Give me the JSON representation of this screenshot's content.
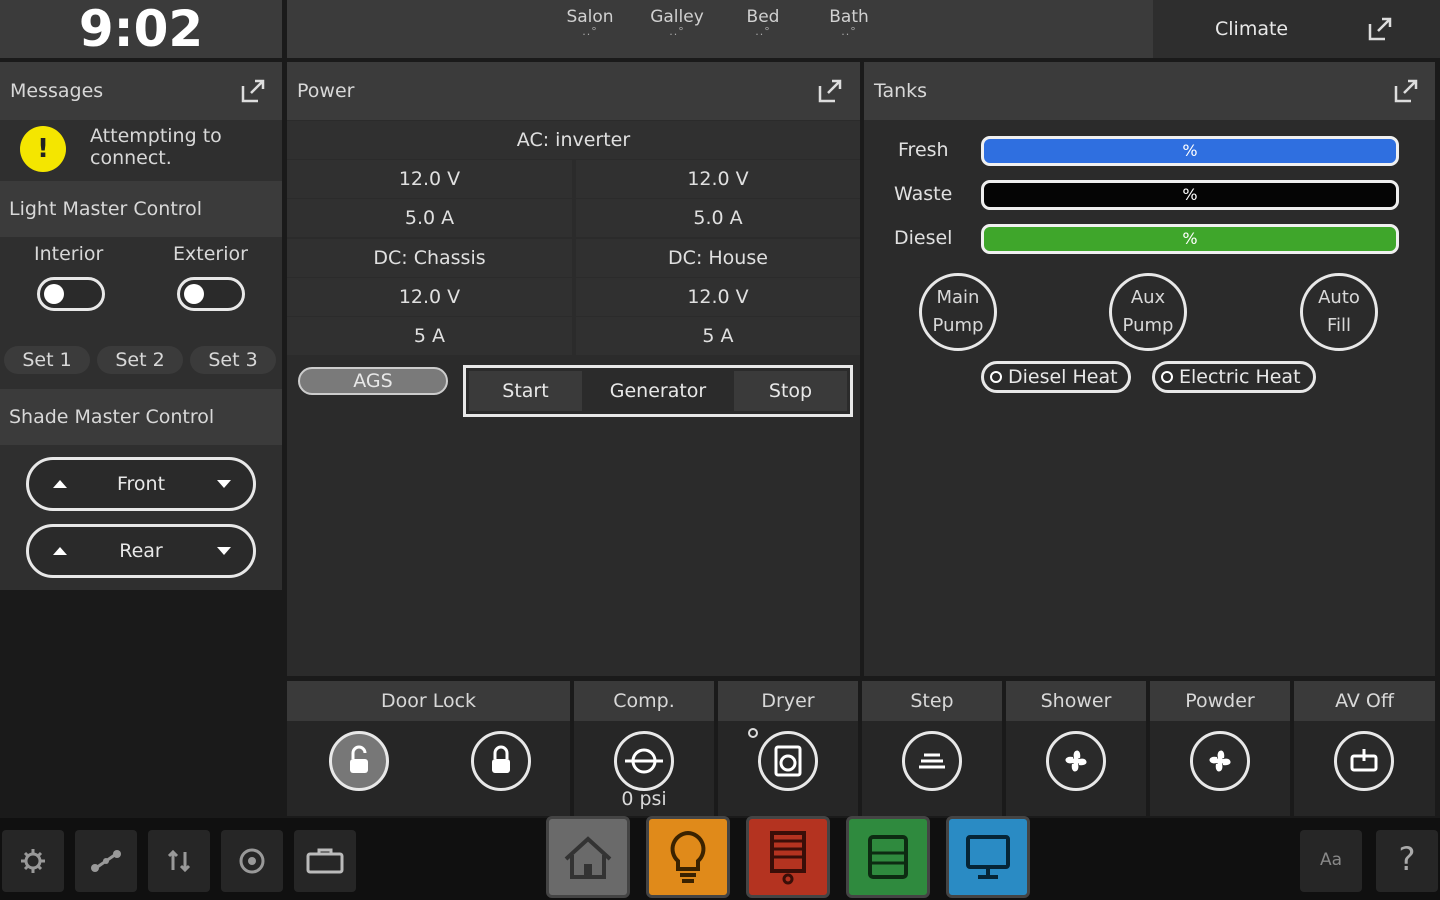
{
  "header": {
    "time": "9:02",
    "rooms": [
      "Salon",
      "Galley",
      "Bed",
      "Bath"
    ],
    "room_indicator": "..°",
    "climate_label": "Climate"
  },
  "messages": {
    "title": "Messages",
    "warning_text": "Attempting to connect.",
    "warning_glyph": "!"
  },
  "light_master": {
    "title": "Light Master Control",
    "interior_label": "Interior",
    "exterior_label": "Exterior",
    "sets": [
      "Set 1",
      "Set 2",
      "Set 3"
    ]
  },
  "shade_master": {
    "title": "Shade Master Control",
    "front_label": "Front",
    "rear_label": "Rear"
  },
  "power": {
    "title": "Power",
    "ac_label": "AC: inverter",
    "ac_v_left": "12.0 V",
    "ac_v_right": "12.0 V",
    "ac_a_left": "5.0 A",
    "ac_a_right": "5.0 A",
    "dc_chassis_label": "DC: Chassis",
    "dc_house_label": "DC: House",
    "dc_chassis_v": "12.0 V",
    "dc_house_v": "12.0 V",
    "dc_chassis_a": "5 A",
    "dc_house_a": "5 A",
    "ags_label": "AGS",
    "gen_start": "Start",
    "gen_label": "Generator",
    "gen_stop": "Stop"
  },
  "tanks": {
    "title": "Tanks",
    "fresh_label": "Fresh",
    "waste_label": "Waste",
    "diesel_label": "Diesel",
    "fresh_value": "%",
    "waste_value": "%",
    "diesel_value": "%",
    "main_pump_l1": "Main",
    "main_pump_l2": "Pump",
    "aux_pump_l1": "Aux",
    "aux_pump_l2": "Pump",
    "auto_fill_l1": "Auto",
    "auto_fill_l2": "Fill",
    "diesel_heat": "Diesel Heat",
    "electric_heat": "Electric Heat",
    "colors": {
      "fresh": "#2f6fe0",
      "waste": "#050505",
      "diesel": "#3fa62b"
    }
  },
  "devices": {
    "door_lock": "Door Lock",
    "comp": "Comp.",
    "comp_value": "0 psi",
    "dryer": "Dryer",
    "step": "Step",
    "shower": "Shower",
    "powder": "Powder",
    "av_off": "AV Off"
  },
  "toolbar": {
    "text_size_label": "Aa",
    "help_label": "?"
  }
}
